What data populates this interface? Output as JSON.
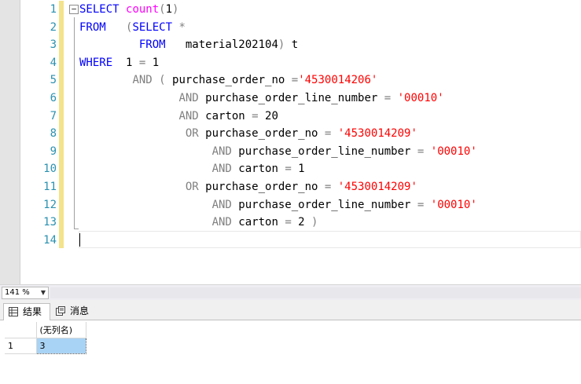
{
  "editor": {
    "line_numbers": [
      "1",
      "2",
      "3",
      "4",
      "5",
      "6",
      "7",
      "8",
      "9",
      "10",
      "11",
      "12",
      "13",
      "14"
    ],
    "fold_symbol": "−",
    "lines": [
      [
        {
          "t": "SELECT",
          "c": "kw"
        },
        {
          "t": " "
        },
        {
          "t": "count",
          "c": "fn"
        },
        {
          "t": "(",
          "c": "gr"
        },
        {
          "t": "1"
        },
        {
          "t": ")",
          "c": "gr"
        }
      ],
      [
        {
          "t": "FROM",
          "c": "kw"
        },
        {
          "t": "   "
        },
        {
          "t": "(",
          "c": "gr"
        },
        {
          "t": "SELECT",
          "c": "kw"
        },
        {
          "t": " "
        },
        {
          "t": "*",
          "c": "gr"
        }
      ],
      [
        {
          "t": "         "
        },
        {
          "t": "FROM",
          "c": "kw"
        },
        {
          "t": "   material202104"
        },
        {
          "t": ")",
          "c": "gr"
        },
        {
          "t": " t"
        }
      ],
      [
        {
          "t": "WHERE",
          "c": "kw"
        },
        {
          "t": "  1 "
        },
        {
          "t": "=",
          "c": "gr"
        },
        {
          "t": " 1"
        }
      ],
      [
        {
          "t": "        "
        },
        {
          "t": "AND",
          "c": "gr"
        },
        {
          "t": " "
        },
        {
          "t": "(",
          "c": "gr"
        },
        {
          "t": " purchase_order_no "
        },
        {
          "t": "=",
          "c": "gr"
        },
        {
          "t": "'4530014206'",
          "c": "st"
        }
      ],
      [
        {
          "t": "               "
        },
        {
          "t": "AND",
          "c": "gr"
        },
        {
          "t": " purchase_order_line_number "
        },
        {
          "t": "=",
          "c": "gr"
        },
        {
          "t": " "
        },
        {
          "t": "'00010'",
          "c": "st"
        }
      ],
      [
        {
          "t": "               "
        },
        {
          "t": "AND",
          "c": "gr"
        },
        {
          "t": " carton "
        },
        {
          "t": "=",
          "c": "gr"
        },
        {
          "t": " 20"
        }
      ],
      [
        {
          "t": "                "
        },
        {
          "t": "OR",
          "c": "gr"
        },
        {
          "t": " purchase_order_no "
        },
        {
          "t": "=",
          "c": "gr"
        },
        {
          "t": " "
        },
        {
          "t": "'4530014209'",
          "c": "st"
        }
      ],
      [
        {
          "t": "                    "
        },
        {
          "t": "AND",
          "c": "gr"
        },
        {
          "t": " purchase_order_line_number "
        },
        {
          "t": "=",
          "c": "gr"
        },
        {
          "t": " "
        },
        {
          "t": "'00010'",
          "c": "st"
        }
      ],
      [
        {
          "t": "                    "
        },
        {
          "t": "AND",
          "c": "gr"
        },
        {
          "t": " carton "
        },
        {
          "t": "=",
          "c": "gr"
        },
        {
          "t": " 1"
        }
      ],
      [
        {
          "t": "                "
        },
        {
          "t": "OR",
          "c": "gr"
        },
        {
          "t": " purchase_order_no "
        },
        {
          "t": "=",
          "c": "gr"
        },
        {
          "t": " "
        },
        {
          "t": "'4530014209'",
          "c": "st"
        }
      ],
      [
        {
          "t": "                    "
        },
        {
          "t": "AND",
          "c": "gr"
        },
        {
          "t": " purchase_order_line_number "
        },
        {
          "t": "=",
          "c": "gr"
        },
        {
          "t": " "
        },
        {
          "t": "'00010'",
          "c": "st"
        }
      ],
      [
        {
          "t": "                    "
        },
        {
          "t": "AND",
          "c": "gr"
        },
        {
          "t": " carton "
        },
        {
          "t": "=",
          "c": "gr"
        },
        {
          "t": " 2 "
        },
        {
          "t": ")",
          "c": "gr"
        }
      ],
      []
    ]
  },
  "statusbar": {
    "zoom": "141 %"
  },
  "tabs": {
    "results_label": "结果",
    "messages_label": "消息"
  },
  "results": {
    "column_header": "(无列名)",
    "row_number": "1",
    "value": "3"
  },
  "colors": {
    "keyword": "#0000ff",
    "function": "#ff00ff",
    "operator": "#808080",
    "string": "#ff0000",
    "line_number": "#2b91af",
    "selected_cell": "#a9d3f5"
  },
  "icons": {
    "results_tab": "grid-icon",
    "messages_tab": "message-icon",
    "zoom_dropdown": "chevron-down-icon"
  }
}
